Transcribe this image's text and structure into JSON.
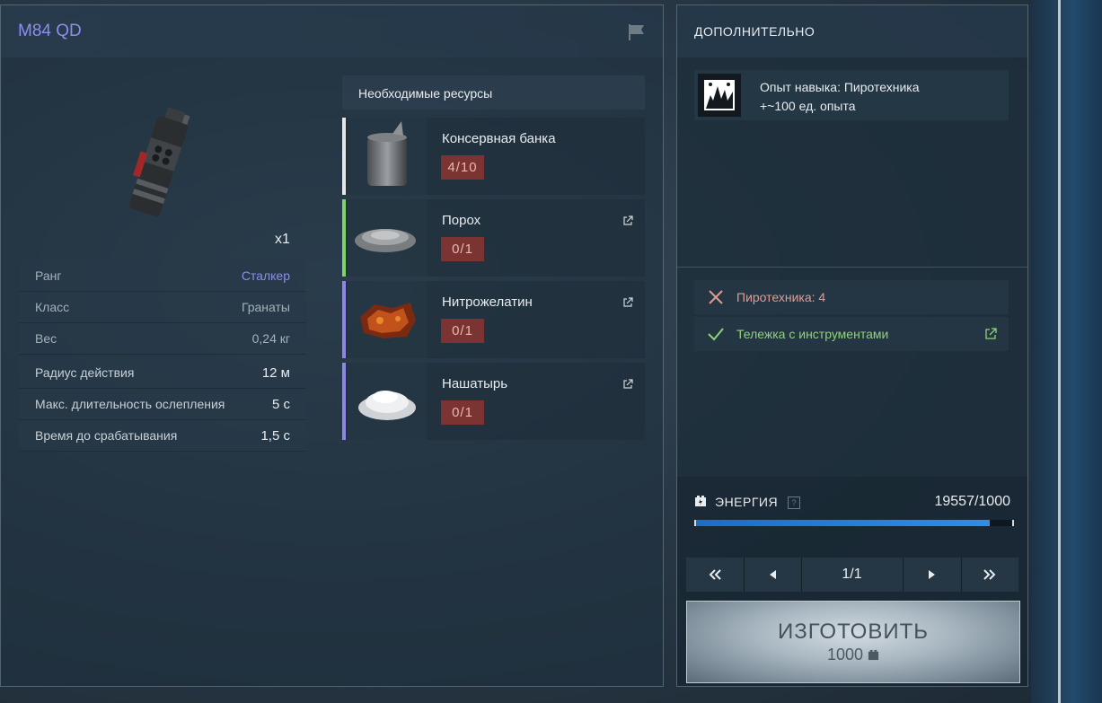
{
  "item": {
    "title": "M84 QD",
    "quantity": "x1"
  },
  "stats": [
    {
      "label": "Ранг",
      "value": "Сталкер"
    },
    {
      "label": "Класс",
      "value": "Гранаты"
    },
    {
      "label": "Вес",
      "value": "0,24 кг"
    }
  ],
  "stats2": [
    {
      "label": "Радиус действия",
      "value": "12 м"
    },
    {
      "label": "Макс. длительность ослепления",
      "value": "5 с"
    },
    {
      "label": "Время до срабатывания",
      "value": "1,5 с"
    }
  ],
  "resources": {
    "header": "Необходимые ресурсы",
    "items": [
      {
        "name": "Консервная банка",
        "count": "4/10",
        "bar_color": "#e6e6e6",
        "icon": "tin-can-icon"
      },
      {
        "name": "Порох",
        "count": "0/1",
        "bar_color": "#7ed36a",
        "icon": "gunpowder-icon"
      },
      {
        "name": "Нитрожелатин",
        "count": "0/1",
        "bar_color": "#8c86e6",
        "icon": "nitrogelatin-icon"
      },
      {
        "name": "Нашатырь",
        "count": "0/1",
        "bar_color": "#8c86e6",
        "icon": "ammonia-icon"
      }
    ]
  },
  "extra": {
    "title": "ДОПОЛНИТЕЛЬНО",
    "skill_line1": "Опыт навыка: Пиротехника",
    "skill_line2": "+~100 ед. опыта"
  },
  "requirements": [
    {
      "text": "Пиротехника: 4",
      "met": false,
      "color": "#e19a92"
    },
    {
      "text": "Тележка с инструментами",
      "met": true,
      "color": "#8fd27c"
    }
  ],
  "energy": {
    "label": "ЭНЕРГИЯ",
    "help": "?",
    "value": "19557/1000",
    "fill_fraction": 0.93
  },
  "pager": {
    "label": "1/1"
  },
  "craft": {
    "label": "ИЗГОТОВИТЬ",
    "cost": "1000"
  }
}
